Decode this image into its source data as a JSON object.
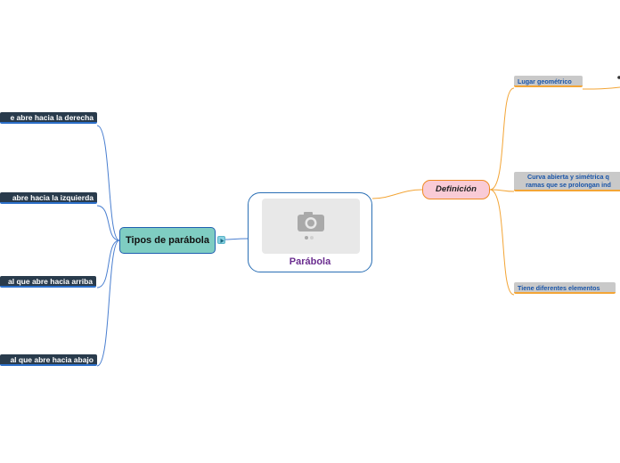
{
  "central": {
    "title": "Parábola",
    "image_icon": "camera-icon"
  },
  "branches": {
    "tipos": {
      "label": "Tipos de parábola",
      "items": [
        "e abre hacia la derecha",
        "abre hacia la izquierda",
        "al que abre hacia arriba",
        "al que abre hacia abajo"
      ]
    },
    "definicion": {
      "label": "Definición",
      "items": [
        {
          "line1": "Lugar geométrico",
          "line2": ""
        },
        {
          "line1": "Curva abierta y simétrica q",
          "line2": "ramas que se prolongan ind"
        },
        {
          "line1": "Tiene diferentes elementos",
          "line2": ""
        }
      ]
    }
  },
  "colors": {
    "left_branch_line": "#4a7fd0",
    "right_branch_line": "#f3a536",
    "central_border": "#2a6fb5",
    "central_title": "#6a2d8f",
    "tipos_fill": "#7fcdc2",
    "definicion_fill": "#f9cbd6",
    "leaf_dark_fill": "#293b4c",
    "leaf_gray_fill": "#c9c9c9"
  }
}
